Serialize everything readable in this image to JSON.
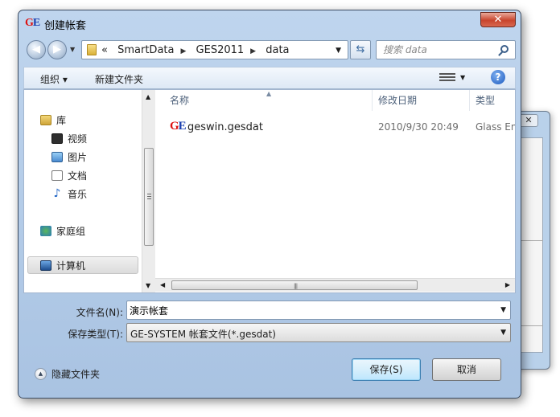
{
  "dialog": {
    "app_logo_g": "G",
    "app_logo_e": "E",
    "title": "创建帐套",
    "close_label": "✕"
  },
  "address": {
    "prefix": "«",
    "crumbs": [
      "SmartData",
      "GES2011",
      "data"
    ]
  },
  "search": {
    "placeholder": "搜索 data"
  },
  "toolbar": {
    "organize_label": "组织 ▾",
    "new_folder_label": "新建文件夹",
    "help_label": "?"
  },
  "nav": {
    "items": [
      {
        "label": "库"
      },
      {
        "label": "视频"
      },
      {
        "label": "图片"
      },
      {
        "label": "文档"
      },
      {
        "label": "音乐"
      },
      {
        "label": "家庭组"
      },
      {
        "label": "计算机"
      }
    ]
  },
  "columns": {
    "name": "名称",
    "date": "修改日期",
    "type": "类型"
  },
  "files": [
    {
      "name": "geswin.gesdat",
      "date": "2010/9/30 20:49",
      "type": "Glass Eng"
    }
  ],
  "form": {
    "filename_label": "文件名(N):",
    "filename_value": "演示帐套",
    "type_label": "保存类型(T):",
    "type_value": "GE-SYSTEM 帐套文件(*.gesdat)"
  },
  "footer": {
    "hide_folders_label": "隐藏文件夹",
    "save_label": "保存(S)",
    "cancel_label": "取消"
  },
  "colors": {
    "title_bg": "#bfd5ee",
    "close_red": "#c8452d",
    "logo_red": "#dd1111",
    "logo_blue": "#1a3fb0"
  }
}
